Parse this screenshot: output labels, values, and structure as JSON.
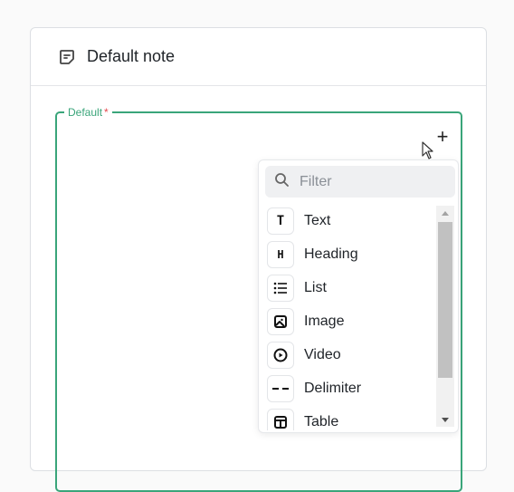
{
  "card": {
    "title": "Default note"
  },
  "field": {
    "label": "Default",
    "required_mark": "*"
  },
  "add_button": {
    "label": "+"
  },
  "block_menu": {
    "filter_placeholder": "Filter",
    "items": [
      {
        "label": "Text",
        "icon": "text-icon",
        "glyph": "T"
      },
      {
        "label": "Heading",
        "icon": "heading-icon",
        "glyph": "H"
      },
      {
        "label": "List",
        "icon": "list-icon"
      },
      {
        "label": "Image",
        "icon": "image-icon"
      },
      {
        "label": "Video",
        "icon": "video-icon"
      },
      {
        "label": "Delimiter",
        "icon": "delimiter-icon"
      },
      {
        "label": "Table",
        "icon": "table-icon"
      }
    ]
  },
  "colors": {
    "accent": "#3aa57a",
    "required": "#e5484d"
  }
}
